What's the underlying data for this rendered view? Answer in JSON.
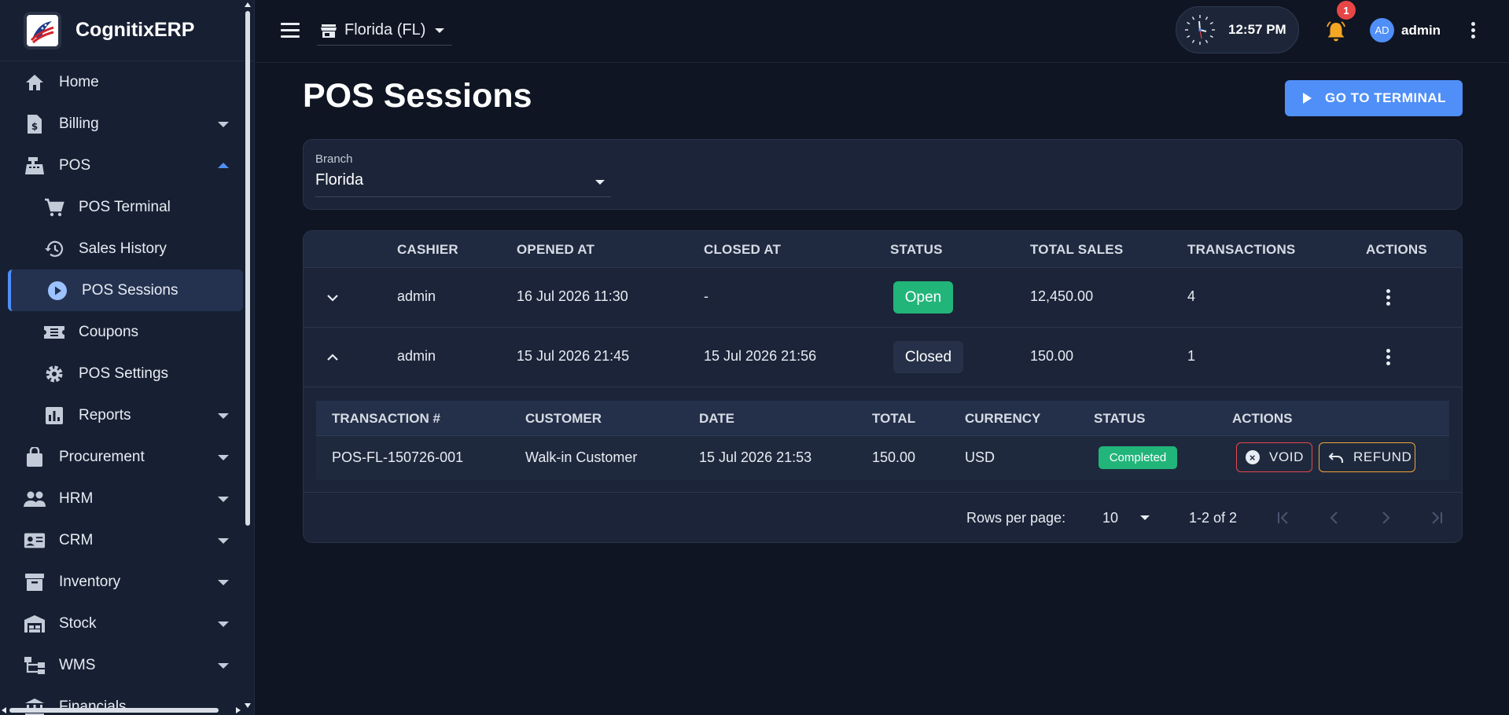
{
  "app": {
    "name": "CognitixERP"
  },
  "colors": {
    "accent": "#4f8ff7",
    "success": "#22b57a",
    "danger": "#e5484d",
    "warning": "#f0a43a",
    "bell": "#f5a623"
  },
  "sidebar": {
    "items": [
      {
        "label": "Home",
        "icon": "home-icon"
      },
      {
        "label": "Billing",
        "icon": "billing-icon"
      },
      {
        "label": "POS",
        "icon": "cash-register-icon"
      },
      {
        "label": "POS Terminal",
        "icon": "cart-icon"
      },
      {
        "label": "Sales History",
        "icon": "history-icon"
      },
      {
        "label": "POS Sessions",
        "icon": "play-circle-icon"
      },
      {
        "label": "Coupons",
        "icon": "ticket-icon"
      },
      {
        "label": "POS Settings",
        "icon": "gear-icon"
      },
      {
        "label": "Reports",
        "icon": "bar-chart-icon"
      },
      {
        "label": "Procurement",
        "icon": "shopping-bag-icon"
      },
      {
        "label": "HRM",
        "icon": "people-icon"
      },
      {
        "label": "CRM",
        "icon": "contact-card-icon"
      },
      {
        "label": "Inventory",
        "icon": "archive-icon"
      },
      {
        "label": "Stock",
        "icon": "warehouse-icon"
      },
      {
        "label": "WMS",
        "icon": "hierarchy-icon"
      },
      {
        "label": "Financials",
        "icon": "bank-icon"
      }
    ]
  },
  "topbar": {
    "branch": "Florida (FL)",
    "time": "12:57 PM",
    "notification_count": "1",
    "user_initials": "AD",
    "user_name": "admin"
  },
  "page": {
    "title": "POS Sessions",
    "terminal_button": "GO TO TERMINAL"
  },
  "filter": {
    "label": "Branch",
    "value": "Florida"
  },
  "table": {
    "headers": [
      "CASHIER",
      "OPENED AT",
      "CLOSED AT",
      "STATUS",
      "TOTAL SALES",
      "TRANSACTIONS",
      "ACTIONS"
    ],
    "rows": [
      {
        "cashier": "admin",
        "opened": "16 Jul 2026 11:30",
        "closed": "-",
        "status": "Open",
        "total": "12,450.00",
        "transactions": "4"
      },
      {
        "cashier": "admin",
        "opened": "15 Jul 2026 21:45",
        "closed": "15 Jul 2026 21:56",
        "status": "Closed",
        "total": "150.00",
        "transactions": "1"
      }
    ]
  },
  "transactions": {
    "headers": [
      "TRANSACTION #",
      "CUSTOMER",
      "DATE",
      "TOTAL",
      "CURRENCY",
      "STATUS",
      "ACTIONS"
    ],
    "rows": [
      {
        "id": "POS-FL-150726-001",
        "customer": "Walk-in Customer",
        "date": "15 Jul 2026 21:53",
        "total": "150.00",
        "currency": "USD",
        "status": "Completed",
        "void_label": "VOID",
        "refund_label": "REFUND"
      }
    ]
  },
  "pagination": {
    "rows_per_page_label": "Rows per page:",
    "rows_per_page": "10",
    "range": "1-2 of 2"
  }
}
